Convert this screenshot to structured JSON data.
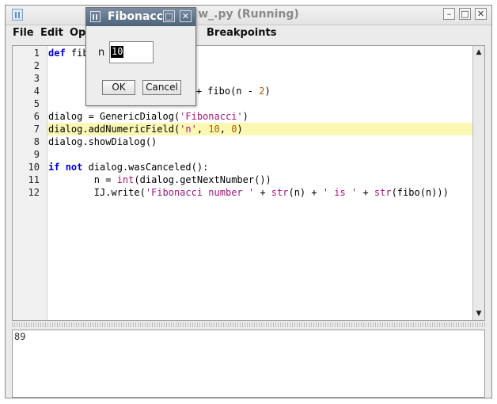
{
  "window": {
    "title": "w_.py (Running)"
  },
  "menu": [
    "File",
    "Edit",
    "Opt",
    "Breakpoints"
  ],
  "code_lines": [
    {
      "number": "1",
      "tokens": [
        {
          "t": "def",
          "c": "kw"
        },
        {
          "t": " fib",
          "c": ""
        }
      ]
    },
    {
      "number": "2",
      "tokens": []
    },
    {
      "number": "3",
      "tokens": []
    },
    {
      "number": "4",
      "tokens": [
        {
          "t": "+ fibo(n - ",
          "c": ""
        },
        {
          "t": "2",
          "c": "num"
        },
        {
          "t": ")",
          "c": ""
        }
      ],
      "offset": 26
    },
    {
      "number": "5",
      "tokens": []
    },
    {
      "number": "6",
      "tokens": [
        {
          "t": "dialog = GenericDialog(",
          "c": ""
        },
        {
          "t": "'Fibonacci'",
          "c": "str"
        },
        {
          "t": ")",
          "c": ""
        }
      ]
    },
    {
      "number": "7",
      "tokens": [
        {
          "t": "dialog.addNumericField(",
          "c": ""
        },
        {
          "t": "'n'",
          "c": "str"
        },
        {
          "t": ", ",
          "c": ""
        },
        {
          "t": "10",
          "c": "num"
        },
        {
          "t": ", ",
          "c": ""
        },
        {
          "t": "0",
          "c": "num"
        },
        {
          "t": ")",
          "c": ""
        }
      ],
      "current": true
    },
    {
      "number": "8",
      "tokens": [
        {
          "t": "dialog.showDialog()",
          "c": ""
        }
      ]
    },
    {
      "number": "9",
      "tokens": []
    },
    {
      "number": "10",
      "tokens": [
        {
          "t": "if",
          "c": "kw"
        },
        {
          "t": " ",
          "c": ""
        },
        {
          "t": "not",
          "c": "kw"
        },
        {
          "t": " dialog.wasCanceled():",
          "c": ""
        }
      ]
    },
    {
      "number": "11",
      "tokens": [
        {
          "t": "        n = ",
          "c": ""
        },
        {
          "t": "int",
          "c": "str"
        },
        {
          "t": "(dialog.getNextNumber())",
          "c": ""
        }
      ]
    },
    {
      "number": "12",
      "tokens": [
        {
          "t": "        IJ.write(",
          "c": ""
        },
        {
          "t": "'Fibonacci number '",
          "c": "str"
        },
        {
          "t": " + ",
          "c": ""
        },
        {
          "t": "str",
          "c": "str"
        },
        {
          "t": "(n) + ",
          "c": ""
        },
        {
          "t": "' is '",
          "c": "str"
        },
        {
          "t": " + ",
          "c": ""
        },
        {
          "t": "str",
          "c": "str"
        },
        {
          "t": "(fibo(n)))",
          "c": ""
        }
      ]
    }
  ],
  "console": {
    "output": "89"
  },
  "dialog": {
    "title": "Fibonacci",
    "field_label": "n",
    "field_value": "10",
    "ok_label": "OK",
    "cancel_label": "Cancel"
  },
  "colors": {
    "current_line": "#fbf8b4",
    "keyword": "#0000cc",
    "string": "#a0177c",
    "number": "#b05a00"
  }
}
